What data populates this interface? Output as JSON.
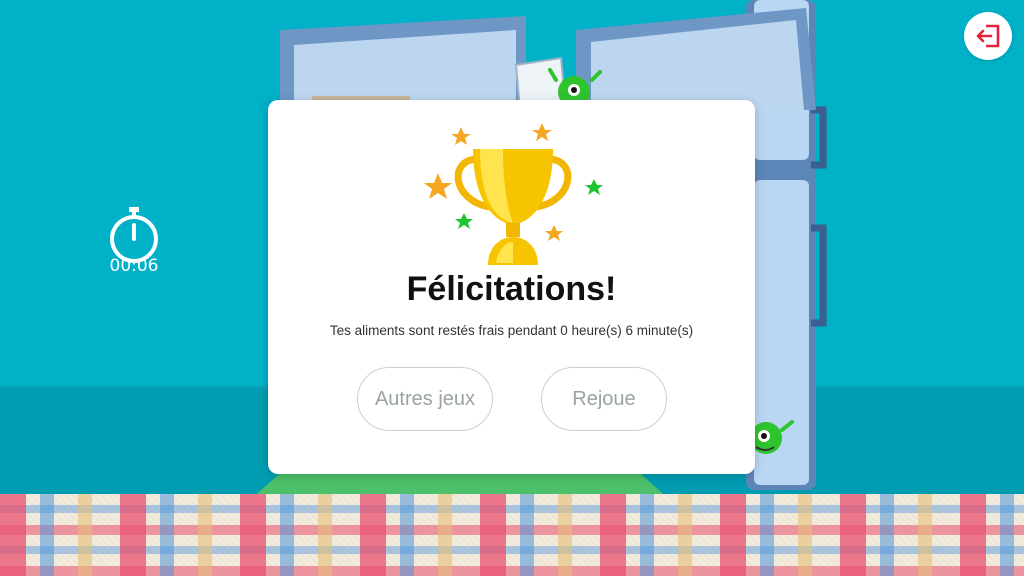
{
  "timer": {
    "value": "00:06"
  },
  "exit_button": {
    "icon": "exit-icon",
    "color": "#e2233d"
  },
  "modal": {
    "title": "Félicitations!",
    "message": "Tes aliments sont restés frais pendant 0 heure(s) 6 minute(s)",
    "buttons": {
      "other_games": "Autres jeux",
      "replay": "Rejoue"
    },
    "icon": "trophy-icon"
  },
  "colors": {
    "background": "#00b1c8",
    "trophy": "#f6c400",
    "star_orange": "#f5a623",
    "star_green": "#1ec42e",
    "monster_green": "#2ec42e"
  }
}
